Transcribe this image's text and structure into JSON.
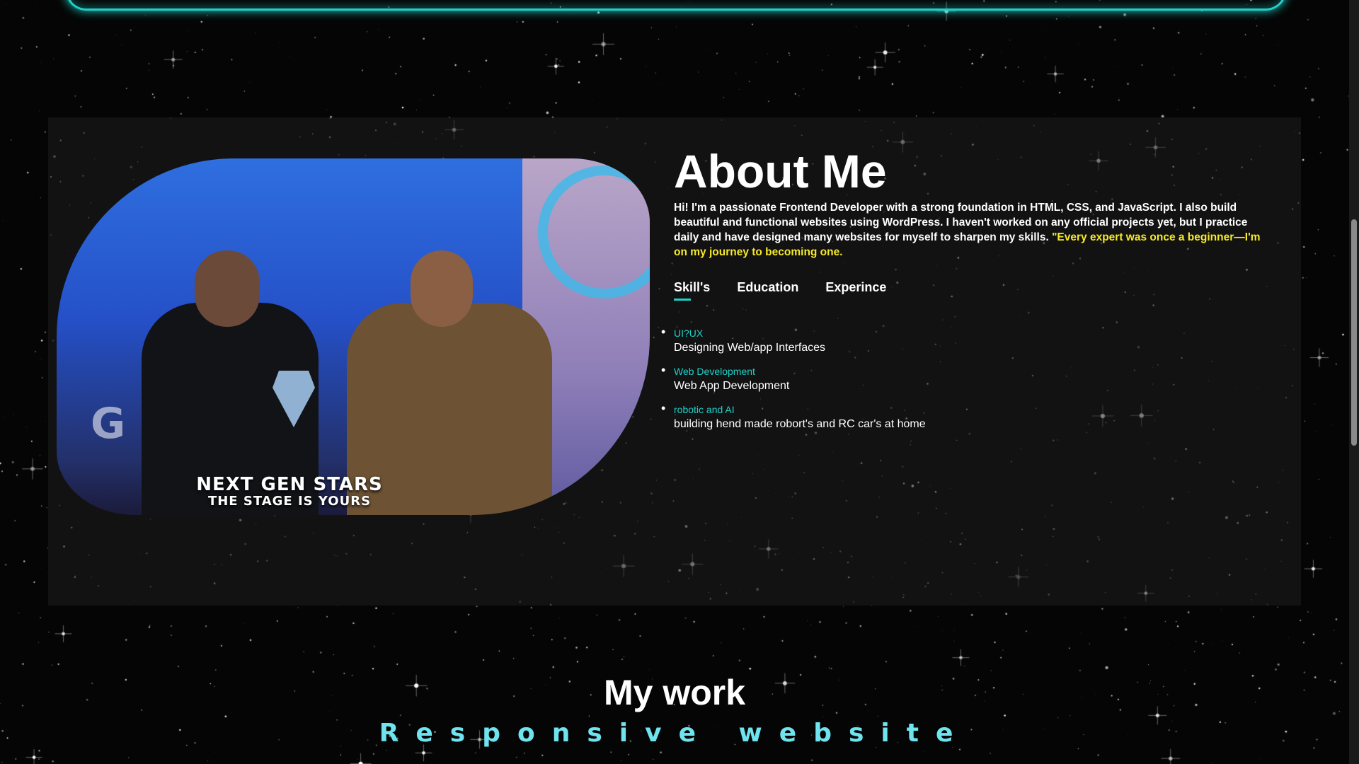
{
  "about": {
    "title": "About Me",
    "intro": "Hi! I'm a passionate Frontend Developer with a strong foundation in HTML, CSS, and JavaScript. I also build beautiful and functional websites using WordPress. I haven't worked on any official projects yet, but I practice daily and have designed many websites for myself to sharpen my skills. ",
    "quote": "\"Every expert was once a beginner—I'm on my journey to becoming one.",
    "photo_caption_line1": "NEXT GEN STARS",
    "photo_caption_line2": "THE STAGE IS YOURS",
    "photo_sign_text": "G"
  },
  "tabs": [
    {
      "label": "Skill's",
      "active": true
    },
    {
      "label": "Education",
      "active": false
    },
    {
      "label": "Experince",
      "active": false
    }
  ],
  "skills": [
    {
      "name": "UI?UX",
      "desc": "Designing Web/app Interfaces"
    },
    {
      "name": "Web Development",
      "desc": "Web App Development"
    },
    {
      "name": "robotic and AI",
      "desc": "building hend made robort's and RC car's at home"
    }
  ],
  "work": {
    "title": "My work",
    "subtitle": "Responsive website"
  },
  "colors": {
    "accent": "#1fd1c8",
    "quote": "#f6e92a",
    "background": "#050505"
  }
}
